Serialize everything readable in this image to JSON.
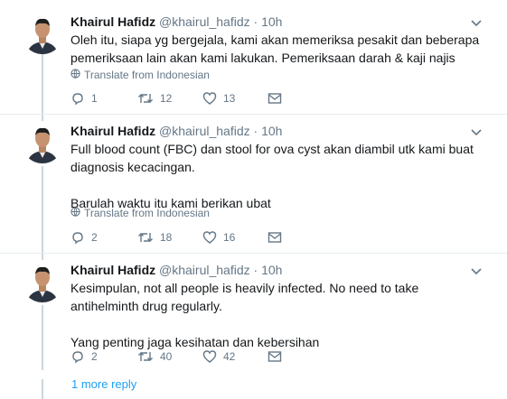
{
  "tweets": [
    {
      "name": "Khairul Hafidz",
      "handle": "@khairul_hafidz",
      "dot": "·",
      "time": "10h",
      "paragraphs": [
        "Oleh itu, siapa yg bergejala, kami akan memeriksa pesakit dan beberapa pemeriksaan lain akan kami lakukan. Pemeriksaan darah & kaji najis"
      ],
      "translate": "Translate from Indonesian",
      "replies": "1",
      "retweets": "12",
      "likes": "13"
    },
    {
      "name": "Khairul Hafidz",
      "handle": "@khairul_hafidz",
      "dot": "·",
      "time": "10h",
      "paragraphs": [
        "Full blood count (FBC) dan stool for ova cyst akan diambil utk kami buat diagnosis kecacingan.",
        "Barulah waktu itu kami berikan ubat"
      ],
      "translate": "Translate from Indonesian",
      "replies": "2",
      "retweets": "18",
      "likes": "16"
    },
    {
      "name": "Khairul Hafidz",
      "handle": "@khairul_hafidz",
      "dot": "·",
      "time": "10h",
      "paragraphs": [
        "Kesimpulan, not all people is heavily infected. No need to take antihelminth drug regularly.",
        "Yang penting jaga kesihatan dan kebersihan"
      ],
      "replies": "2",
      "retweets": "40",
      "likes": "42"
    }
  ],
  "more_replies": "1 more reply",
  "colors": {
    "accent": "#1da1f2",
    "secondary": "#657786",
    "divider": "#e6ecf0",
    "thread": "#ccd6dd"
  },
  "icons": {
    "reply": "reply-icon",
    "retweet": "retweet-icon",
    "like": "heart-icon",
    "dm": "envelope-icon",
    "translate": "globe-icon",
    "menu": "chevron-down-icon"
  }
}
